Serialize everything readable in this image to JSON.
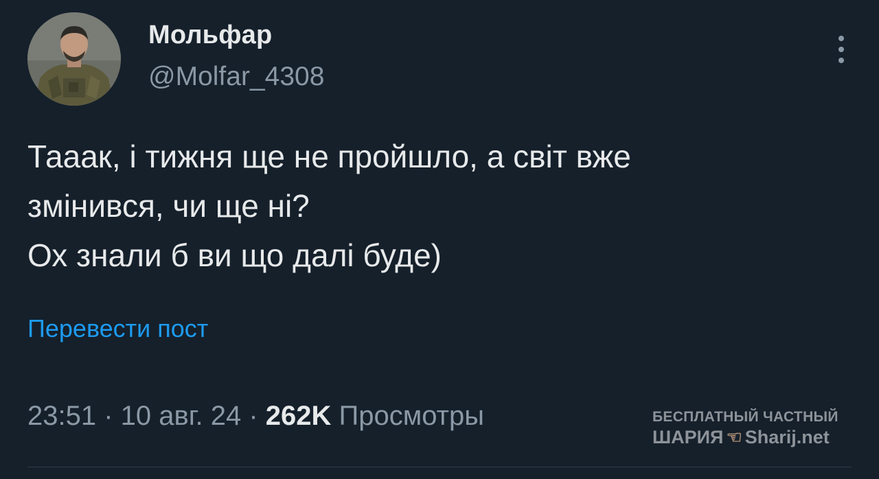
{
  "author": {
    "display_name": "Мольфар",
    "handle": "@Molfar_4308"
  },
  "tweet": {
    "lines": [
      "Тааак, і тижня ще не пройшло, а світ вже",
      "змінився, чи ще ні?",
      "Ох знали б ви що далі буде)"
    ],
    "translate_label": "Перевести пост"
  },
  "meta": {
    "time": "23:51",
    "separator": "·",
    "date": "10 авг. 24",
    "views_count": "262K",
    "views_label": "Просмотры"
  },
  "watermark": {
    "line1": "БЕСПЛАТНЫЙ ЧАСТНЫЙ",
    "left_word": "ШАРИЯ",
    "icon": "pointing-hand-icon",
    "right_word": "Sharij.net"
  },
  "colors": {
    "background": "#15202b",
    "primary_text": "#e7e9ea",
    "secondary_text": "#8b98a5",
    "link": "#1d9bf0"
  }
}
